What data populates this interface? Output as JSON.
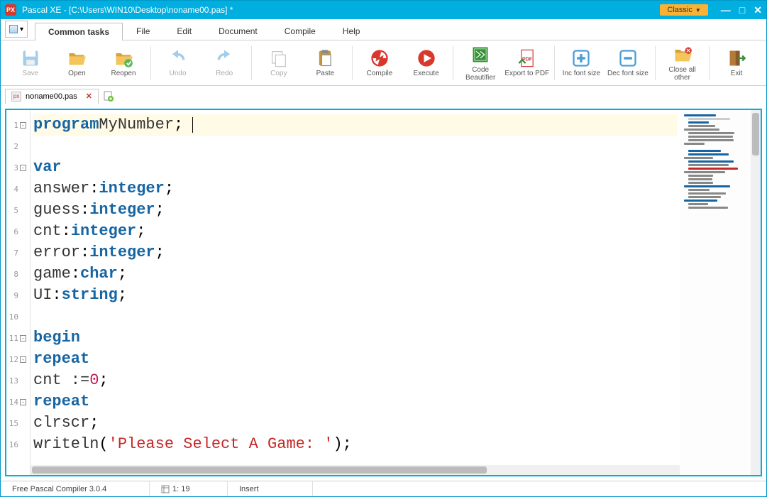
{
  "titlebar": {
    "app_icon_text": "PX",
    "title": "Pascal XE  -  [C:\\Users\\WIN10\\Desktop\\noname00.pas] *",
    "classic_label": "Classic",
    "minimize": "—",
    "maximize": "□",
    "close": "✕"
  },
  "menutabs": {
    "items": [
      "Common tasks",
      "File",
      "Edit",
      "Document",
      "Compile",
      "Help"
    ],
    "active_index": 0
  },
  "ribbon": [
    {
      "id": "save",
      "label": "Save",
      "disabled": true,
      "group": 0
    },
    {
      "id": "open",
      "label": "Open",
      "disabled": false,
      "group": 0
    },
    {
      "id": "reopen",
      "label": "Reopen",
      "disabled": false,
      "group": 0
    },
    {
      "id": "undo",
      "label": "Undo",
      "disabled": true,
      "group": 1
    },
    {
      "id": "redo",
      "label": "Redo",
      "disabled": true,
      "group": 1
    },
    {
      "id": "copy",
      "label": "Copy",
      "disabled": true,
      "group": 2
    },
    {
      "id": "paste",
      "label": "Paste",
      "disabled": false,
      "group": 2
    },
    {
      "id": "compile",
      "label": "Compile",
      "disabled": false,
      "group": 3
    },
    {
      "id": "execute",
      "label": "Execute",
      "disabled": false,
      "group": 3
    },
    {
      "id": "beautifier",
      "label": "Code Beautifier",
      "disabled": false,
      "group": 4
    },
    {
      "id": "pdf",
      "label": "Export to PDF",
      "disabled": false,
      "group": 4
    },
    {
      "id": "incfont",
      "label": "Inc font size",
      "disabled": false,
      "group": 5
    },
    {
      "id": "decfont",
      "label": "Dec font size",
      "disabled": false,
      "group": 5
    },
    {
      "id": "closeall",
      "label": "Close all other",
      "disabled": false,
      "group": 6
    },
    {
      "id": "exit",
      "label": "Exit",
      "disabled": false,
      "group": 7
    }
  ],
  "filetabs": {
    "items": [
      {
        "name": "noname00.pas",
        "modified": true
      }
    ]
  },
  "code_lines": [
    {
      "n": 1,
      "fold": "-",
      "hl": true,
      "tokens": [
        [
          "kw",
          "program"
        ],
        [
          "",
          " "
        ],
        [
          "ident",
          "MyNumber"
        ],
        [
          "",
          ";"
        ]
      ],
      "cursor_after": true
    },
    {
      "n": 2,
      "tokens": []
    },
    {
      "n": 3,
      "fold": "-",
      "tokens": [
        [
          "kw",
          "var"
        ]
      ]
    },
    {
      "n": 4,
      "tokens": [
        [
          "",
          "   "
        ],
        [
          "ident",
          "answer"
        ],
        [
          "",
          ":"
        ],
        [
          "type",
          "integer"
        ],
        [
          "",
          ";"
        ]
      ]
    },
    {
      "n": 5,
      "tokens": [
        [
          "",
          "   "
        ],
        [
          "ident",
          "guess"
        ],
        [
          "",
          ":"
        ],
        [
          "type",
          "integer"
        ],
        [
          "",
          ";"
        ]
      ]
    },
    {
      "n": 6,
      "tokens": [
        [
          "",
          "   "
        ],
        [
          "ident",
          "cnt"
        ],
        [
          "",
          ":"
        ],
        [
          "type",
          "integer"
        ],
        [
          "",
          ";"
        ]
      ]
    },
    {
      "n": 7,
      "tokens": [
        [
          "",
          "   "
        ],
        [
          "ident",
          "error"
        ],
        [
          "",
          ":"
        ],
        [
          "type",
          "integer"
        ],
        [
          "",
          ";"
        ]
      ]
    },
    {
      "n": 8,
      "tokens": [
        [
          "",
          "   "
        ],
        [
          "ident",
          "game"
        ],
        [
          "",
          ":"
        ],
        [
          "type",
          "char"
        ],
        [
          "",
          ";"
        ]
      ]
    },
    {
      "n": 9,
      "tokens": [
        [
          "",
          "   "
        ],
        [
          "ident",
          "UI"
        ],
        [
          "",
          ":"
        ],
        [
          "type",
          "string"
        ],
        [
          "",
          ";"
        ]
      ]
    },
    {
      "n": 10,
      "tokens": []
    },
    {
      "n": 11,
      "fold": "-",
      "tokens": [
        [
          "kw",
          "begin"
        ]
      ]
    },
    {
      "n": 12,
      "fold": "-",
      "tokens": [
        [
          "",
          "   "
        ],
        [
          "kw",
          "repeat"
        ]
      ]
    },
    {
      "n": 13,
      "tokens": [
        [
          "",
          "      "
        ],
        [
          "ident",
          "cnt :="
        ],
        [
          "",
          " "
        ],
        [
          "num",
          "0"
        ],
        [
          "",
          ";"
        ]
      ]
    },
    {
      "n": 14,
      "fold": "-",
      "tokens": [
        [
          "",
          "      "
        ],
        [
          "kw",
          "repeat"
        ]
      ]
    },
    {
      "n": 15,
      "tokens": [
        [
          "",
          "         "
        ],
        [
          "ident",
          "clrscr"
        ],
        [
          "",
          ";"
        ]
      ]
    },
    {
      "n": 16,
      "tokens": [
        [
          "",
          "         "
        ],
        [
          "ident",
          "writeln"
        ],
        [
          "",
          "("
        ],
        [
          "str",
          "'Please Select A Game: '"
        ],
        [
          "",
          ");"
        ]
      ]
    }
  ],
  "statusbar": {
    "compiler": "Free Pascal Compiler 3.0.4",
    "cursor": "1: 19",
    "mode": "Insert"
  },
  "colors": {
    "accent": "#00aee0"
  }
}
